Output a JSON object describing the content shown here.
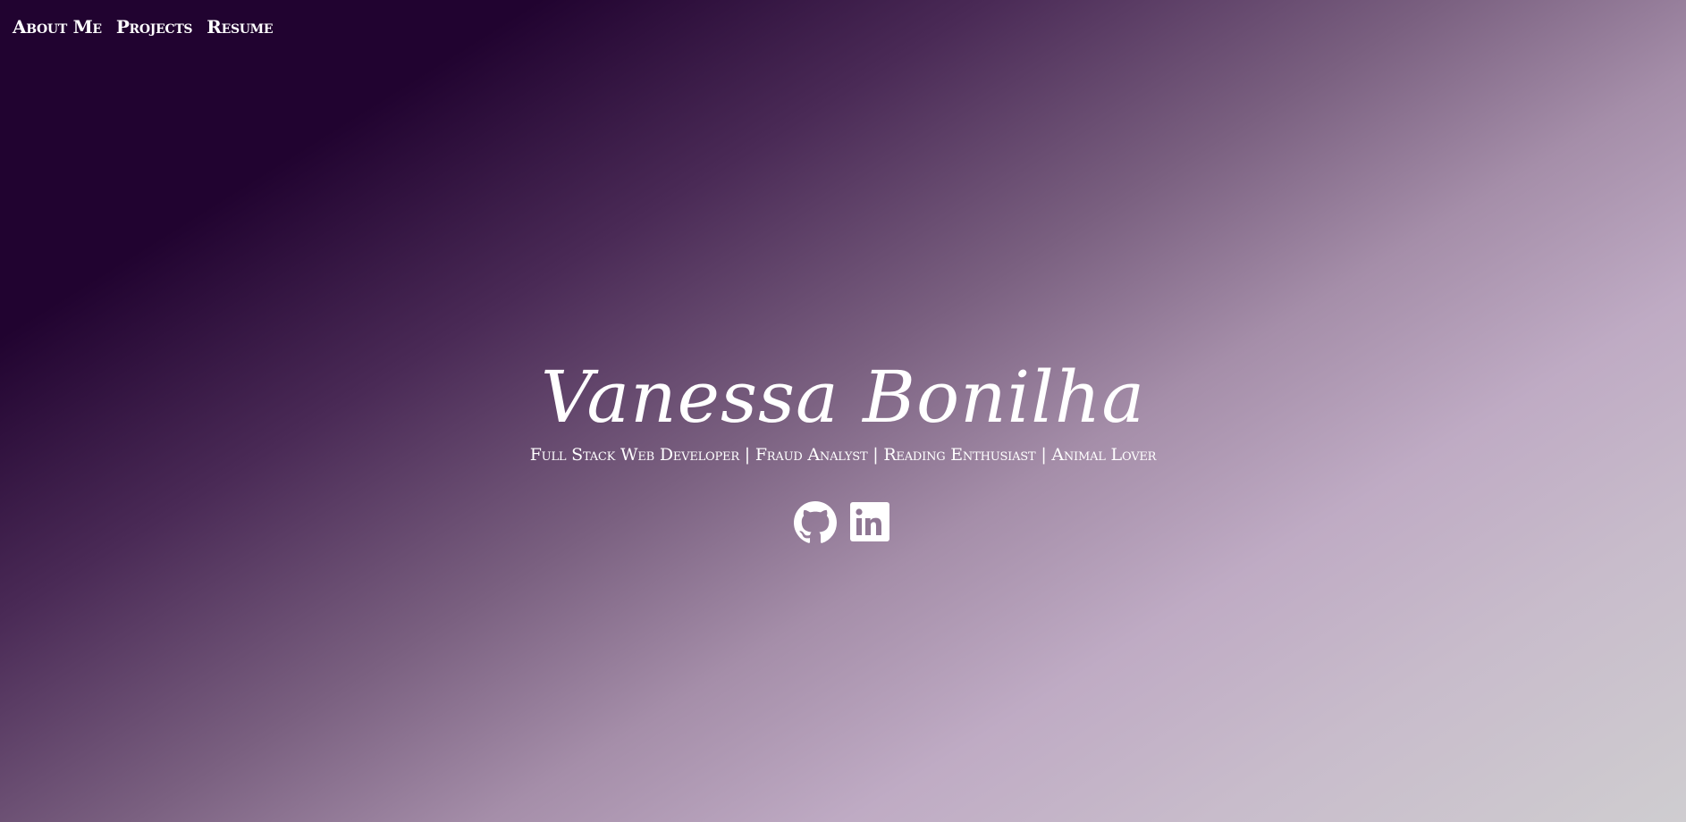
{
  "nav": {
    "items": [
      {
        "label": "About Me"
      },
      {
        "label": "Projects"
      },
      {
        "label": "Resume"
      }
    ]
  },
  "hero": {
    "name": "Vanessa Bonilha",
    "subtitle": "Full Stack Web Developer | Fraud Analyst | Reading Enthusiast | Animal Lover"
  },
  "socials": [
    {
      "icon": "github-icon"
    },
    {
      "icon": "linkedin-icon"
    }
  ],
  "colors": {
    "text": "#ffffff",
    "gradient_dark": "#210330",
    "gradient_light": "#cfcdd0"
  }
}
